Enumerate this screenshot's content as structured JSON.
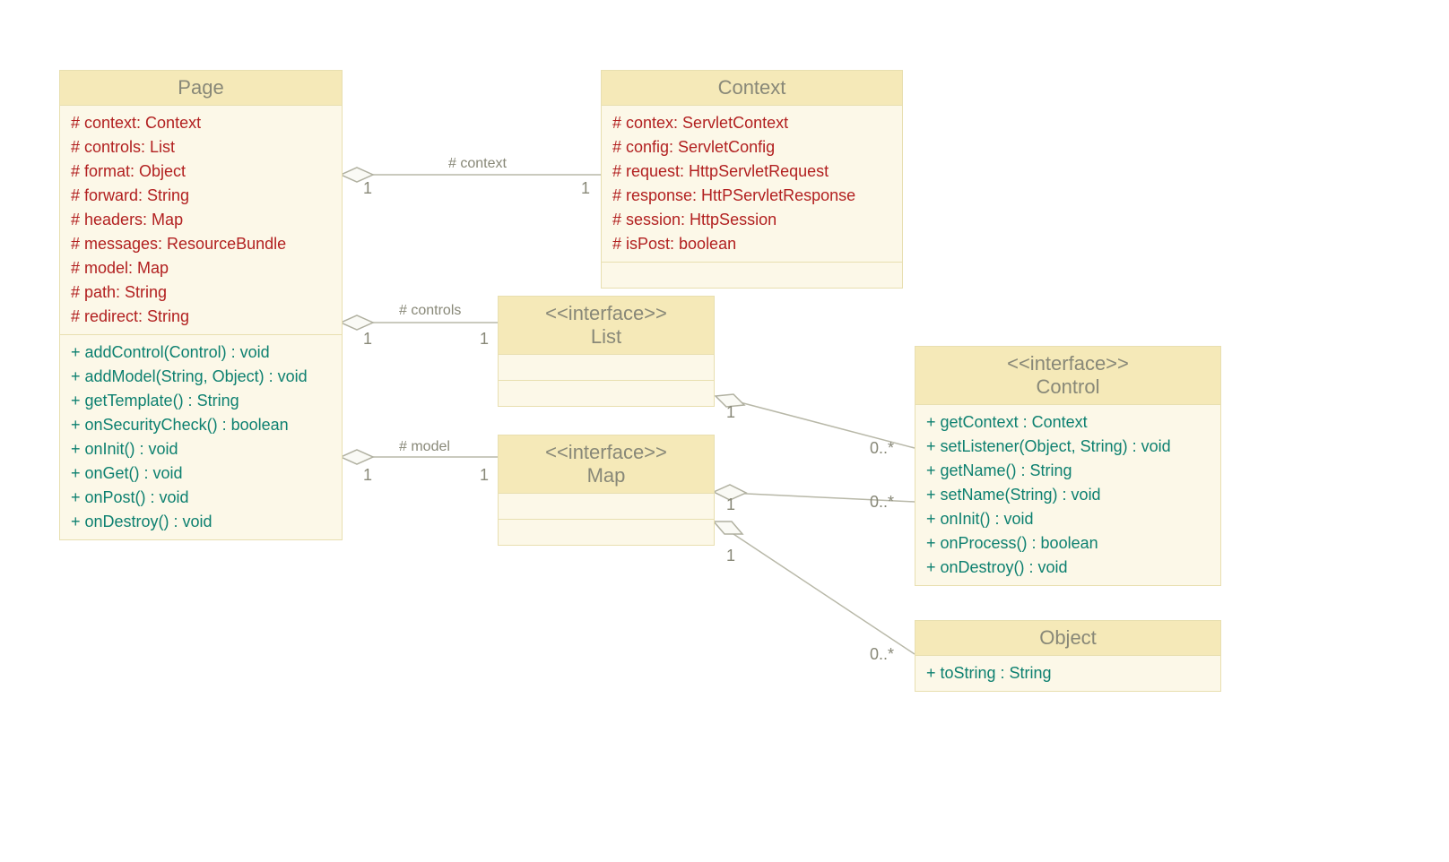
{
  "classes": {
    "page": {
      "name": "Page",
      "attrs": [
        "# context: Context",
        "# controls: List",
        "# format: Object",
        "# forward: String",
        "# headers: Map",
        "# messages: ResourceBundle",
        "# model: Map",
        "# path: String",
        "# redirect: String"
      ],
      "methods": [
        "+ addControl(Control) : void",
        "+ addModel(String, Object) : void",
        "+ getTemplate() : String",
        "+ onSecurityCheck() : boolean",
        "+ onInit() : void",
        "+ onGet() : void",
        "+ onPost() : void",
        "+ onDestroy() : void"
      ]
    },
    "context": {
      "name": "Context",
      "attrs": [
        "# contex: ServletContext",
        "# config: ServletConfig",
        "# request: HttpServletRequest",
        "# response: HttPServletResponse",
        "# session: HttpSession",
        "# isPost: boolean"
      ]
    },
    "list": {
      "stereotype": "<<interface>>",
      "name": "List"
    },
    "map": {
      "stereotype": "<<interface>>",
      "name": "Map"
    },
    "control": {
      "stereotype": "<<interface>>",
      "name": "Control",
      "methods": [
        "+ getContext : Context",
        "+ setListener(Object, String) : void",
        "+ getName() : String",
        "+ setName(String) : void",
        "+ onInit() : void",
        "+ onProcess() : boolean",
        "+ onDestroy() : void"
      ]
    },
    "object": {
      "name": "Object",
      "methods": [
        "+ toString : String"
      ]
    }
  },
  "labels": {
    "context": "# context",
    "controls": "# controls",
    "model": "# model"
  },
  "mult": {
    "one": "1",
    "many": "0..*"
  }
}
